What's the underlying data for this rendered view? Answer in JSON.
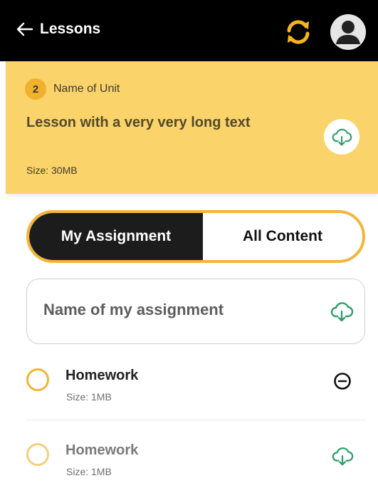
{
  "header": {
    "title": "Lessons",
    "back_icon": "arrow-left-icon",
    "sync_icon": "sync-icon",
    "avatar_icon": "user-avatar-icon"
  },
  "banner": {
    "unit_number": "2",
    "unit_name": "Name of Unit",
    "lesson_title": "Lesson with a very very long text",
    "size": "Size: 30MB",
    "download_icon": "cloud-download-icon"
  },
  "segment": {
    "active": "My Assignment",
    "inactive": "All Content"
  },
  "assignment": {
    "name": "Name of my assignment",
    "download_icon": "cloud-download-icon"
  },
  "items": [
    {
      "title": "Homework",
      "size": "Size: 1MB",
      "action_icon": "remove-circle-icon"
    },
    {
      "title": "Homework",
      "size": "Size: 1MB",
      "action_icon": "cloud-download-icon"
    }
  ],
  "colors": {
    "header_bg": "#000000",
    "banner_bg": "#FAD46A",
    "accent": "#F3B53A",
    "download_green": "#2E9E6B",
    "segment_active_bg": "#1C1C1C"
  }
}
